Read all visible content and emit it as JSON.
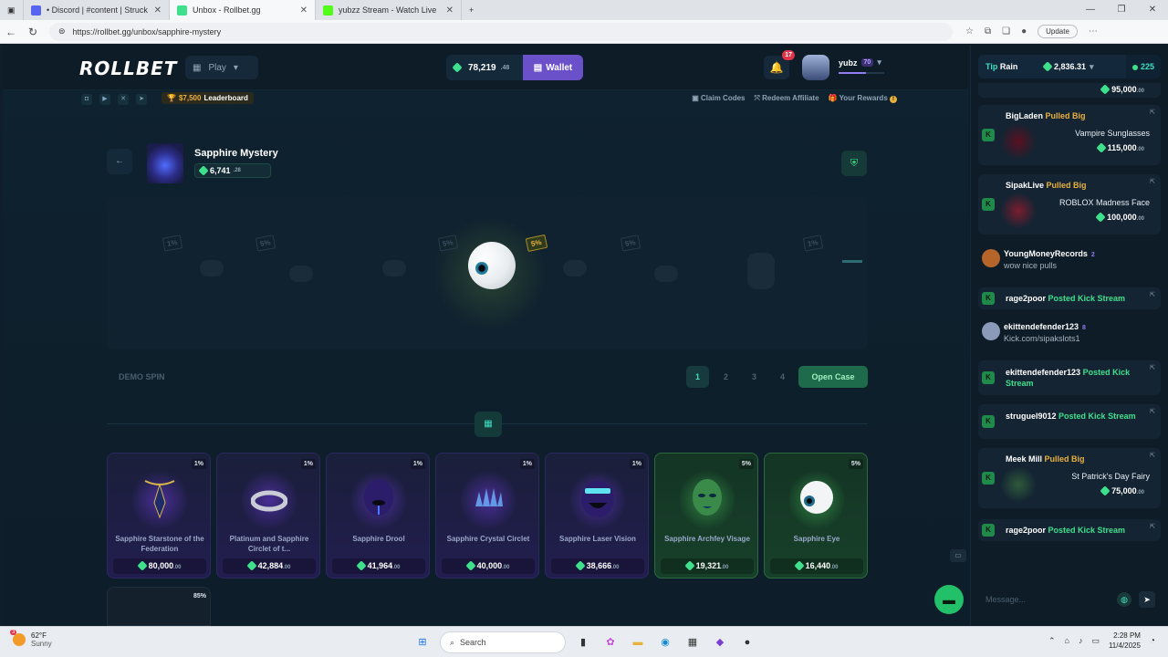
{
  "browser": {
    "tabs": [
      {
        "label": "• Discord | #content | Struck",
        "fav": "#5865f2",
        "active": false
      },
      {
        "label": "Unbox - Rollbet.gg",
        "fav": "#3fe08c",
        "active": true
      },
      {
        "label": "yubzz Stream - Watch Live",
        "fav": "#53fc18",
        "active": false
      }
    ],
    "url": "https://rollbet.gg/unbox/sapphire-mystery",
    "update_label": "Update"
  },
  "header": {
    "logo": "ROLLBET",
    "play_label": "Play",
    "balance_main": "78,219",
    "balance_dec": ".48",
    "wallet_label": "Wallet",
    "notif_count": "17",
    "username": "yubz",
    "level": "70",
    "xp_progress": 0.6
  },
  "subbar": {
    "leaderboard_amount": "$7,500",
    "leaderboard_label": "Leaderboard",
    "claim_codes": "Claim Codes",
    "redeem_affiliate": "Redeem Affiliate",
    "your_rewards": "Your Rewards",
    "rewards_badge": "!"
  },
  "case": {
    "title": "Sapphire Mystery",
    "price_main": "6,741",
    "price_dec": ".28"
  },
  "spinner": {
    "tags": [
      "1%",
      "5%",
      "5%",
      "5%",
      "1%"
    ],
    "center_tag": "5%"
  },
  "controls": {
    "demo_label": "DEMO SPIN",
    "pages": [
      "1",
      "2",
      "3",
      "4"
    ],
    "active_page": "1",
    "open_label": "Open Case"
  },
  "items": [
    {
      "name": "Sapphire Starstone of the Federation",
      "price": "80,000",
      "dec": ".00",
      "pct": "1%",
      "tier": "purple"
    },
    {
      "name": "Platinum and Sapphire Circlet of t...",
      "price": "42,884",
      "dec": ".00",
      "pct": "1%",
      "tier": "purple"
    },
    {
      "name": "Sapphire Drool",
      "price": "41,964",
      "dec": ".00",
      "pct": "1%",
      "tier": "purple"
    },
    {
      "name": "Sapphire Crystal Circlet",
      "price": "40,000",
      "dec": ".00",
      "pct": "1%",
      "tier": "purple"
    },
    {
      "name": "Sapphire Laser Vision",
      "price": "38,666",
      "dec": ".00",
      "pct": "1%",
      "tier": "purple"
    },
    {
      "name": "Sapphire Archfey Visage",
      "price": "19,321",
      "dec": ".00",
      "pct": "5%",
      "tier": "green"
    },
    {
      "name": "Sapphire Eye",
      "price": "16,440",
      "dec": ".00",
      "pct": "5%",
      "tier": "green"
    }
  ],
  "next_item_pct": "85%",
  "sidebar": {
    "tip_label": "Tip",
    "rain_label": "Rain",
    "rain_amount": "2,836.31",
    "online_count": "225",
    "top_value": "95,000",
    "top_value_dec": ".00",
    "feed": [
      {
        "type": "pull",
        "user": "BigLaden",
        "action": "Pulled Big",
        "item": "Vampire Sunglasses",
        "value": "115,000",
        "dec": ".00"
      },
      {
        "type": "pull",
        "user": "SipakLive",
        "action": "Pulled Big",
        "item": "ROBLOX Madness Face",
        "value": "100,000",
        "dec": ".00"
      },
      {
        "type": "chat",
        "user": "YoungMoneyRecords",
        "level": "2",
        "text": "wow nice pulls"
      },
      {
        "type": "stream",
        "user": "rage2poor",
        "action": "Posted Kick Stream"
      },
      {
        "type": "chat",
        "user": "ekittendefender123",
        "level": "8",
        "text": "Kick.com/sipakslots1"
      },
      {
        "type": "stream2",
        "user": "ekittendefender123",
        "action_a": "Posted",
        "action_b": "Kick Stream"
      },
      {
        "type": "stream2",
        "user": "struguel9012",
        "action_a": "Posted Kick",
        "action_b": "Stream"
      },
      {
        "type": "pull",
        "user": "Meek Mill",
        "action": "Pulled Big",
        "item": "St Patrick's Day Fairy",
        "value": "75,000",
        "dec": ".00"
      },
      {
        "type": "stream",
        "user": "rage2poor",
        "action": "Posted Kick Stream"
      }
    ],
    "message_placeholder": "Message..."
  },
  "taskbar": {
    "temp": "62°F",
    "condition": "Sunny",
    "weather_badge": "3",
    "search_label": "Search",
    "time": "2:28 PM",
    "date": "11/4/2025"
  }
}
